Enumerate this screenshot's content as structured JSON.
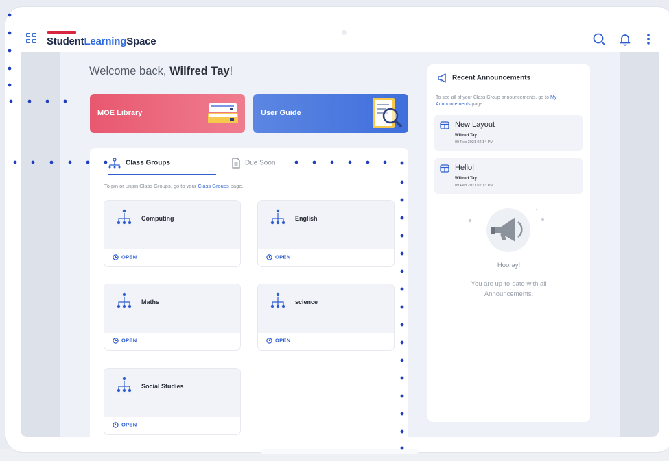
{
  "app": {
    "brand_part1": "Student",
    "brand_part2": "Learning",
    "brand_part3": "Space"
  },
  "colors": {
    "brand_blue": "#2f6be0",
    "moe_red": "#e85870",
    "guide_blue": "#4f7ae0",
    "dot_blue": "#1f3fbf"
  },
  "icons": {
    "menu": "grid-icon",
    "search": "search-icon",
    "notifications": "bell-icon",
    "more": "more-vertical-icon"
  },
  "welcome": {
    "prefix": "Welcome back, ",
    "name": "Wilfred Tay",
    "suffix": "!"
  },
  "banners": {
    "moe_library": "MOE Library",
    "user_guide": "User Guide"
  },
  "tabs": {
    "class_groups": "Class Groups",
    "due_soon": "Due Soon"
  },
  "hint": {
    "text": "To pin or unpin Class Groups, go to your ",
    "link": "Class Groups",
    "suffix": " page."
  },
  "class_groups": [
    {
      "name": "Computing",
      "action": "OPEN"
    },
    {
      "name": "English",
      "action": "OPEN"
    },
    {
      "name": "Maths",
      "action": "OPEN"
    },
    {
      "name": "science",
      "action": "OPEN"
    },
    {
      "name": "Social Studies",
      "action": "OPEN"
    }
  ],
  "announcements": {
    "title": "Recent Announcements",
    "desc": "To see all of your Class Group announcements, go to ",
    "desc_link": "My Announcements",
    "desc_suffix": " page.",
    "items": [
      {
        "title": "New Layout",
        "author": "Wilfred Tay",
        "date": "09 Feb 2021 02:14 PM"
      },
      {
        "title": "Hello!",
        "author": "Wilfred Tay",
        "date": "09 Feb 2021 02:13 PM"
      }
    ],
    "empty_title": "Hooray!",
    "empty_text": "You are up-to-date with all Announcements."
  }
}
